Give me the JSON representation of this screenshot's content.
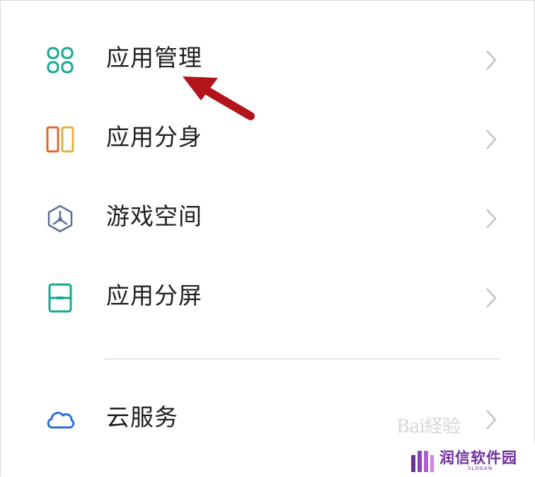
{
  "menu": {
    "items": [
      {
        "label": "应用管理",
        "icon": "apps-grid-icon"
      },
      {
        "label": "应用分身",
        "icon": "app-clone-icon"
      },
      {
        "label": "游戏空间",
        "icon": "game-space-icon"
      },
      {
        "label": "应用分屏",
        "icon": "split-screen-icon"
      },
      {
        "label": "云服务",
        "icon": "cloud-icon"
      }
    ]
  },
  "annotation": {
    "arrow_color": "#b3131b"
  },
  "watermark": {
    "text": "Bai経验"
  },
  "brand": {
    "name": "润信软件园",
    "slogan": "SLOGAN",
    "color": "#6e2f9c"
  },
  "colors": {
    "teal": "#15a88f",
    "orange": "#e06a2c",
    "amber": "#e8b13a",
    "blue": "#2a6fd8",
    "slate": "#5b6f95"
  }
}
